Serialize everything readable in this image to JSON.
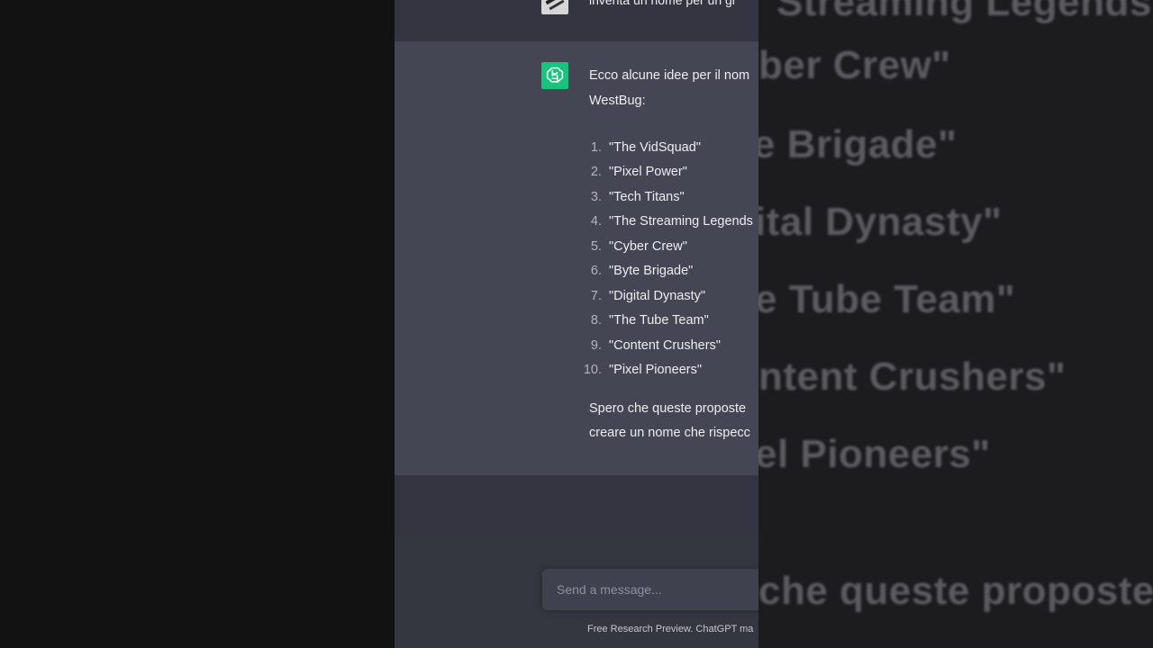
{
  "user_message": {
    "text": "inventa un nome per un gr"
  },
  "assistant_message": {
    "intro_line1": "Ecco alcune idee per il nom",
    "intro_line2": "WestBug:",
    "list": [
      {
        "num": "1.",
        "label": "\"The VidSquad\""
      },
      {
        "num": "2.",
        "label": "\"Pixel Power\""
      },
      {
        "num": "3.",
        "label": "\"Tech Titans\""
      },
      {
        "num": "4.",
        "label": "\"The Streaming Legends"
      },
      {
        "num": "5.",
        "label": "\"Cyber Crew\""
      },
      {
        "num": "6.",
        "label": "\"Byte Brigade\""
      },
      {
        "num": "7.",
        "label": "\"Digital Dynasty\""
      },
      {
        "num": "8.",
        "label": "\"The Tube Team\""
      },
      {
        "num": "9.",
        "label": "\"Content Crushers\""
      },
      {
        "num": "10.",
        "label": "\"Pixel Pioneers\""
      }
    ],
    "outro_line1": "Spero che queste proposte",
    "outro_line2": "creare un nome che rispecc"
  },
  "composer": {
    "placeholder": "Send a message..."
  },
  "disclaimer": "Free Research Preview. ChatGPT ma",
  "background_zoom": {
    "lines": [
      "Streaming Legends",
      "ber Crew\"",
      "e Brigade\"",
      "ital Dynasty\"",
      "e Tube Team\"",
      "ntent Crushers\"",
      "el Pioneers\"",
      "che queste proposte"
    ]
  },
  "colors": {
    "accent": "#19c37d",
    "assistant_bg": "#444654",
    "chat_bg": "#343541"
  }
}
